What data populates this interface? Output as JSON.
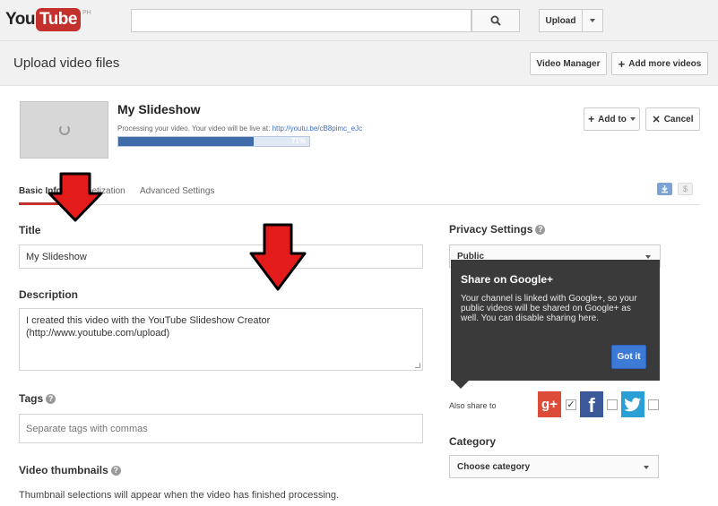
{
  "topbar": {
    "logo_you": "You",
    "logo_tube": "Tube",
    "logo_country": "PH",
    "search_placeholder": "",
    "upload_label": "Upload"
  },
  "page": {
    "title": "Upload video files",
    "video_manager_label": "Video Manager",
    "add_more_label": "Add more videos"
  },
  "upload_item": {
    "title": "My Slideshow",
    "processing_text": "Processing your video. Your video will be live at:",
    "video_link": "http://youtu.be/cB8pimc_eJc",
    "progress_percent": 71,
    "progress_label": "71%",
    "add_to_label": "Add to",
    "cancel_label": "Cancel"
  },
  "tabs": [
    {
      "label": "Basic Info",
      "active": true
    },
    {
      "label": "Monetization",
      "active": false
    },
    {
      "label": "Advanced Settings",
      "active": false
    }
  ],
  "form": {
    "title_label": "Title",
    "title_value": "My Slideshow",
    "description_label": "Description",
    "description_value": "I created this video with the YouTube Slideshow Creator (http://www.youtube.com/upload)",
    "tags_label": "Tags",
    "tags_placeholder": "Separate tags with commas",
    "thumbnails_label": "Video thumbnails",
    "thumbnails_note": "Thumbnail selections will appear when the video has finished processing."
  },
  "right": {
    "privacy_label": "Privacy Settings",
    "privacy_value": "Public",
    "also_share_label": "Also share to",
    "category_label": "Category",
    "category_value": "Choose category",
    "social": [
      {
        "name": "google-plus",
        "glyph": "g+",
        "color": "#dd4b39",
        "checked": true
      },
      {
        "name": "facebook",
        "glyph": "f",
        "color": "#3b5998",
        "checked": false
      },
      {
        "name": "twitter",
        "glyph": "t",
        "color": "#2a9fd6",
        "checked": false
      }
    ]
  },
  "popup": {
    "title": "Share on Google+",
    "body": "Your channel is linked with Google+, so your public videos will be shared on Google+ as well. You can disable sharing here.",
    "button_label": "Got it"
  },
  "colors": {
    "brand_red": "#c4302b",
    "progress_blue": "#3f6ca9",
    "annotation_red": "#e31b1b",
    "popup_bg": "#3a3a3a",
    "primary_button": "#3d7ad6"
  }
}
